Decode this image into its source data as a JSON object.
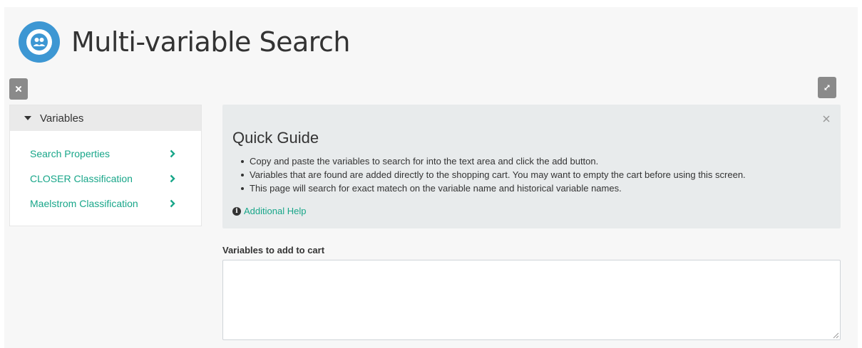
{
  "header": {
    "title": "Multi-variable Search",
    "logo_icon": "users-circle-icon",
    "logo_color": "#3d97d3"
  },
  "toolbar": {
    "close_icon": "close-icon",
    "expand_icon": "expand-arrows-icon"
  },
  "sidebar": {
    "heading": "Variables",
    "items": [
      {
        "label": "Search Properties"
      },
      {
        "label": "CLOSER Classification"
      },
      {
        "label": "Maelstrom Classification"
      }
    ],
    "link_color": "#18a689"
  },
  "guide": {
    "title": "Quick Guide",
    "points": [
      "Copy and paste the variables to search for into the text area and click the add button.",
      "Variables that are found are added directly to the shopping cart. You may want to empty the cart before using this screen.",
      "This page will search for exact matech on the variable name and historical variable names."
    ],
    "help_link": "Additional Help"
  },
  "form": {
    "label": "Variables to add to cart",
    "value": "",
    "placeholder": ""
  }
}
